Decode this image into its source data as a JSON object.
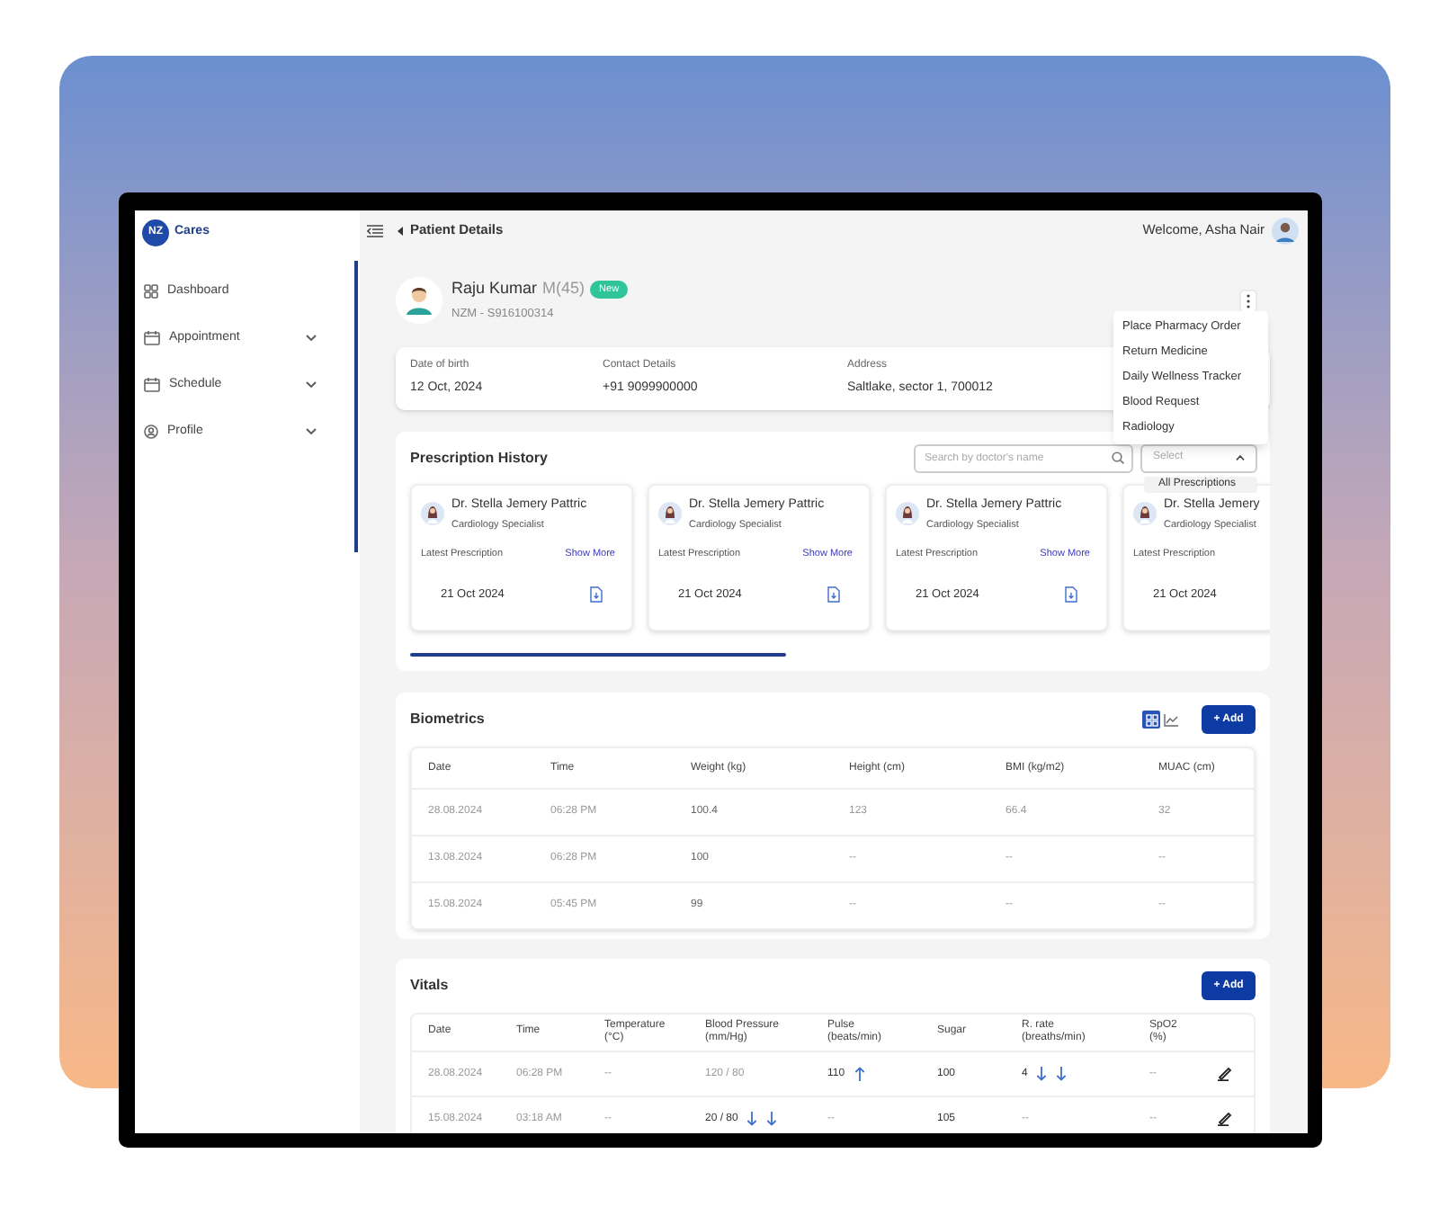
{
  "brand": {
    "logo": "NZ",
    "name": "Cares"
  },
  "sidebar": {
    "items": [
      {
        "label": "Dashboard",
        "kind": "grid",
        "expandable": false
      },
      {
        "label": "Appointment",
        "kind": "calendar",
        "expandable": true
      },
      {
        "label": "Schedule",
        "kind": "calendar",
        "expandable": true
      },
      {
        "label": "Profile",
        "kind": "user",
        "expandable": true
      }
    ]
  },
  "header": {
    "title": "Patient Details",
    "welcome": "Welcome, Asha Nair"
  },
  "patient": {
    "name": "Raju Kumar",
    "gender_age": "M(45)",
    "badge": "New",
    "id": "NZM - S916100314"
  },
  "details": [
    {
      "label": "Date of birth",
      "value": "12 Oct, 2024"
    },
    {
      "label": "Contact Details",
      "value": "+91 9099900000"
    },
    {
      "label": "Address",
      "value": "Saltlake, sector 1, 700012"
    }
  ],
  "actions_menu": {
    "expanded": true,
    "items": [
      "Place Pharmacy Order",
      "Return Medicine",
      "Daily Wellness Tracker",
      "Blood Request",
      "Radiology"
    ]
  },
  "prescription_history": {
    "title": "Prescription History",
    "search": {
      "placeholder": "Search by doctor's name"
    },
    "filter": {
      "placeholder": "Select",
      "expanded": true,
      "options": [
        "All Prescriptions"
      ]
    },
    "cards": [
      {
        "doctor": "Dr. Stella Jemery Pattric",
        "specialty": "Cardiology Specialist",
        "label": "Latest Prescription",
        "link": "Show More",
        "date": "21 Oct 2024"
      },
      {
        "doctor": "Dr. Stella Jemery Pattric",
        "specialty": "Cardiology Specialist",
        "label": "Latest Prescription",
        "link": "Show More",
        "date": "21 Oct 2024"
      },
      {
        "doctor": "Dr. Stella Jemery Pattric",
        "specialty": "Cardiology Specialist",
        "label": "Latest Prescription",
        "link": "Show More",
        "date": "21 Oct 2024"
      },
      {
        "doctor": "Dr. Stella Jemery",
        "specialty": "Cardiology Specialist",
        "label": "Latest Prescription",
        "date": "21 Oct 2024"
      }
    ]
  },
  "biometrics": {
    "title": "Biometrics",
    "views": [
      {
        "kind": "grid",
        "selected": true
      },
      {
        "kind": "chart",
        "selected": false
      }
    ],
    "add": "+ Add",
    "columns": [
      "Date",
      "Time",
      "Weight (kg)",
      "Height (cm)",
      "BMI (kg/m2)",
      "MUAC (cm)"
    ],
    "rows": [
      [
        "28.08.2024",
        "06:28 PM",
        "100.4",
        "123",
        "66.4",
        "32"
      ],
      [
        "13.08.2024",
        "06:28 PM",
        "100",
        "--",
        "--",
        "--"
      ],
      [
        "15.08.2024",
        "05:45 PM",
        "99",
        "--",
        "--",
        "--"
      ]
    ]
  },
  "vitals": {
    "title": "Vitals",
    "add": "+ Add",
    "columns": [
      {
        "title": "Date"
      },
      {
        "title": "Time"
      },
      {
        "title": "Temperature",
        "unit": "(°C)"
      },
      {
        "title": "Blood Pressure",
        "unit": "(mm/Hg)"
      },
      {
        "title": "Pulse",
        "unit": "(beats/min)"
      },
      {
        "title": "Sugar"
      },
      {
        "title": "R. rate",
        "unit": "(breaths/min)"
      },
      {
        "title": "SpO2",
        "unit": "(%)"
      }
    ],
    "rows": [
      [
        {
          "text": "28.08.2024"
        },
        {
          "text": "06:28 PM"
        },
        {
          "text": "--"
        },
        {
          "text": "120 / 80"
        },
        {
          "text": "110",
          "trend": [
            {
              "kind": "up"
            }
          ]
        },
        {
          "text": "100",
          "strong": true
        },
        {
          "text": "4",
          "trend": [
            {
              "kind": "down"
            },
            {
              "kind": "down"
            }
          ]
        },
        {
          "text": "--"
        }
      ],
      [
        {
          "text": "15.08.2024"
        },
        {
          "text": "03:18 AM"
        },
        {
          "text": "--"
        },
        {
          "text": "20 / 80",
          "trend": [
            {
              "kind": "down"
            },
            {
              "kind": "down"
            }
          ]
        },
        {
          "text": "--"
        },
        {
          "text": "105",
          "strong": true
        },
        {
          "text": "--"
        },
        {
          "text": "--"
        }
      ]
    ]
  }
}
